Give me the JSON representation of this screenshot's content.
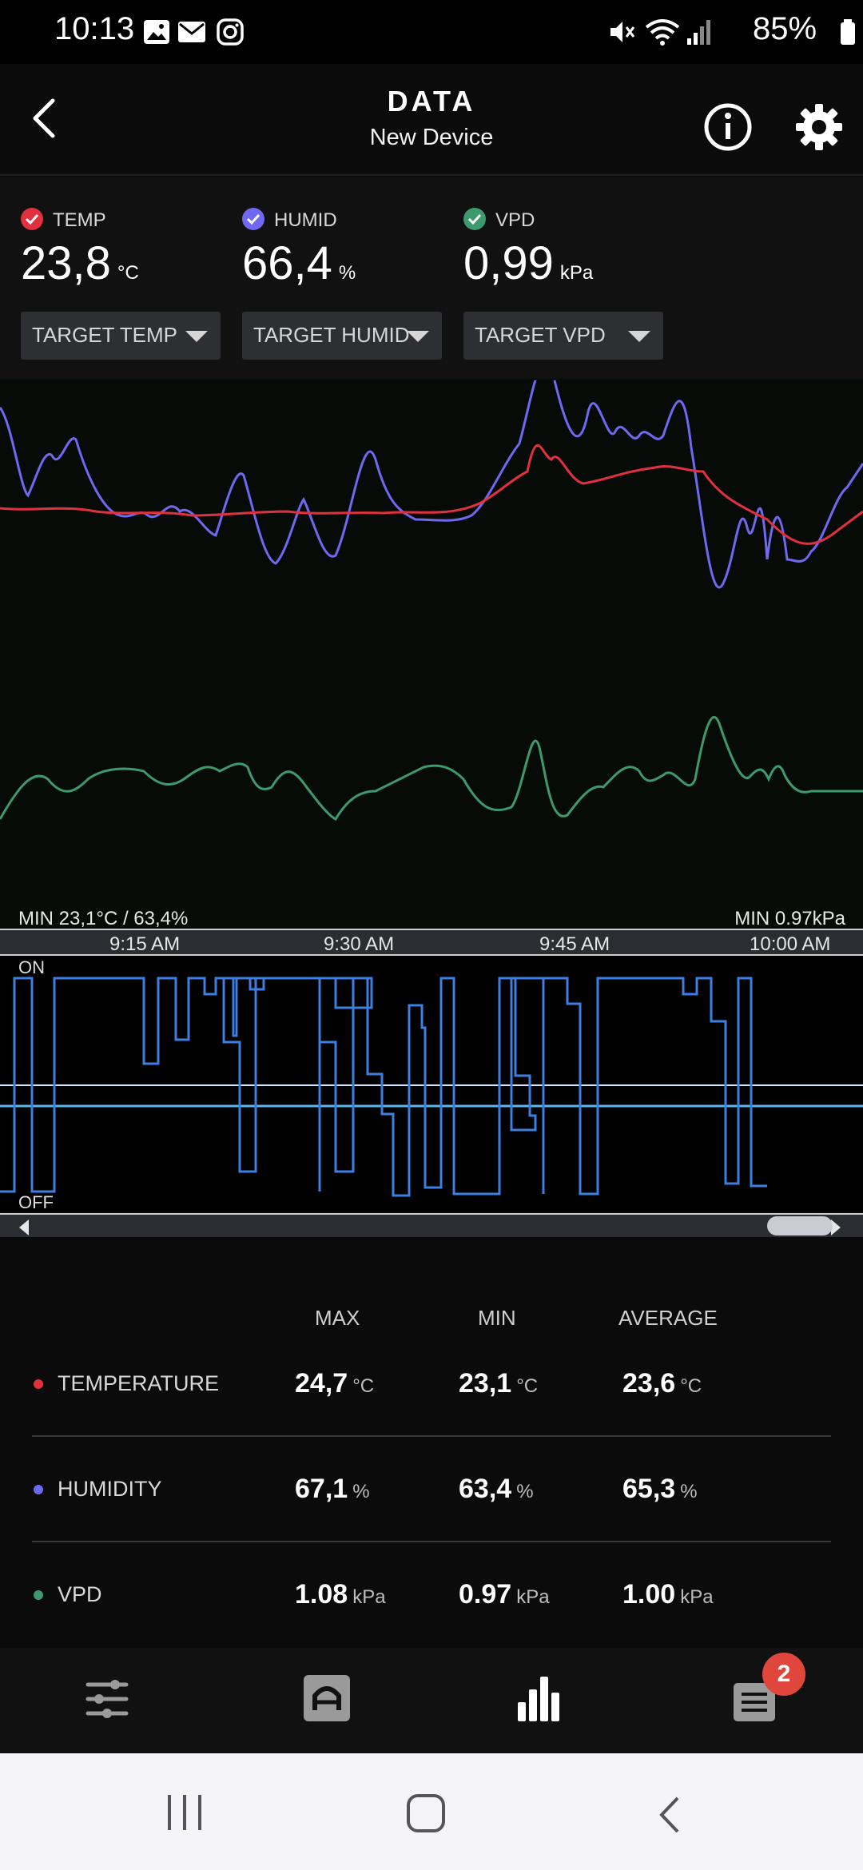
{
  "status_bar": {
    "time": "10:13",
    "battery": "85%"
  },
  "header": {
    "title": "DATA",
    "subtitle": "New Device"
  },
  "readings": [
    {
      "label": "TEMP",
      "value": "23,8",
      "unit": "°C",
      "color": "#e0313c",
      "dropdown": "TARGET TEMP"
    },
    {
      "label": "HUMID",
      "value": "66,4",
      "unit": "%",
      "color": "#7068f0",
      "dropdown": "TARGET HUMID"
    },
    {
      "label": "VPD",
      "value": "0,99",
      "unit": "kPa",
      "color": "#3d9a6d",
      "dropdown": "TARGET VPD"
    }
  ],
  "chart": {
    "min_left": "MIN 23,1°C / 63,4%",
    "min_right": "MIN 0.97kPa",
    "time_ticks": [
      "9:15 AM",
      "9:30 AM",
      "9:45 AM",
      "10:00 AM"
    ],
    "on_label": "ON",
    "off_label": "OFF",
    "colors": {
      "temp": "#e0313c",
      "humid": "#7068f0",
      "vpd": "#3d9a6d",
      "onoff": "#3d7fe0"
    }
  },
  "stats": {
    "headers": [
      "MAX",
      "MIN",
      "AVERAGE"
    ],
    "rows": [
      {
        "name": "TEMPERATURE",
        "color": "#e0313c",
        "max": "24,7",
        "min": "23,1",
        "avg": "23,6",
        "unit": "°C"
      },
      {
        "name": "HUMIDITY",
        "color": "#7068f0",
        "max": "67,1",
        "min": "63,4",
        "avg": "65,3",
        "unit": "%"
      },
      {
        "name": "VPD",
        "color": "#3d9a6d",
        "max": "1.08",
        "min": "0.97",
        "avg": "1.00",
        "unit": "kPa"
      }
    ]
  },
  "bottom_nav": {
    "items": [
      "sliders-icon",
      "device-icon",
      "bar-chart-icon",
      "list-icon"
    ],
    "badge": "2"
  }
}
